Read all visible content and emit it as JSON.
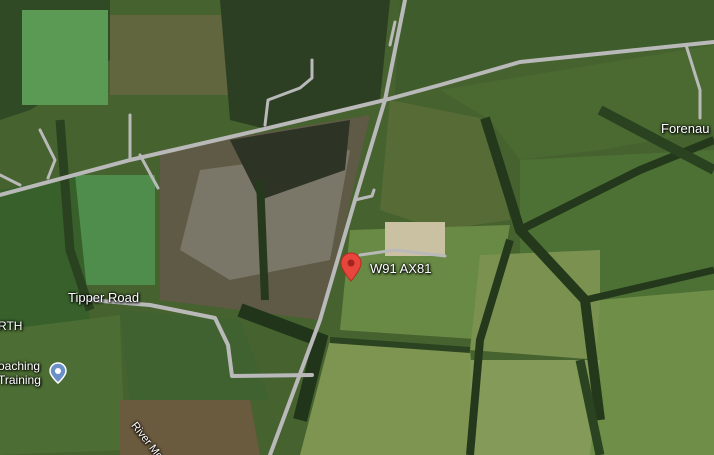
{
  "map": {
    "type": "satellite",
    "labels": {
      "tipper_road": "Tipper Road",
      "forenaughts": "Forenau",
      "rth": "RTH",
      "coaching_line1": "oaching",
      "coaching_line2": "Training",
      "river": "River Morell"
    },
    "pin": {
      "eircode": "W91 AX81",
      "color": "#e8453c"
    },
    "poi": {
      "icon": "map-pin-icon",
      "color": "#6b8fc7"
    },
    "road_color": "#b9b9b9"
  }
}
